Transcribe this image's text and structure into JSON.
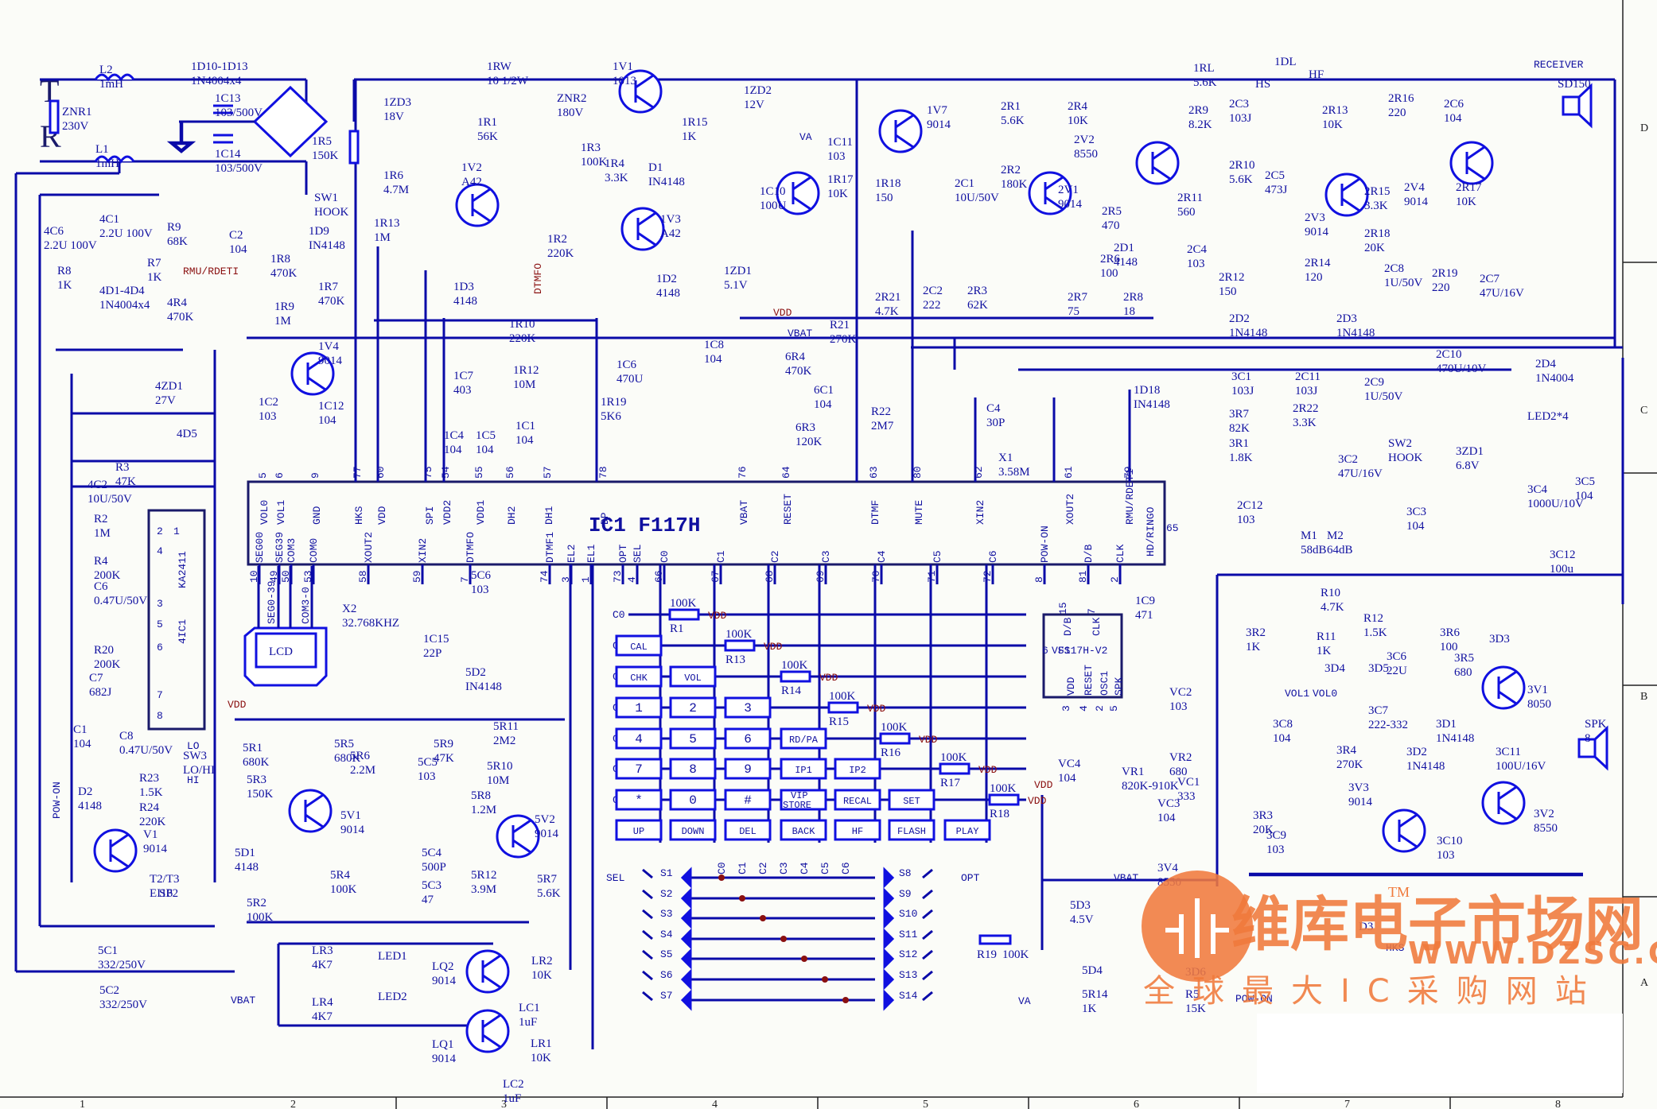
{
  "diagram": {
    "type": "circuit-schematic",
    "main_ic": {
      "name": "IC1",
      "part": "F117H"
    },
    "sub_ic": {
      "part": "F117H-V2"
    },
    "amp_ic": {
      "part": "KA2411",
      "ref": "4IC1"
    },
    "lcd_label": "LCD",
    "receiver_label": "RECEIVER",
    "input_labels": {
      "tip": "T",
      "ring": "R"
    }
  },
  "frame": {
    "columns": [
      "1",
      "2",
      "3",
      "4",
      "5",
      "6",
      "7",
      "8"
    ],
    "rows": [
      "D",
      "C",
      "B",
      "A"
    ]
  },
  "ic_top_pins": [
    {
      "num": "5",
      "name": "VOL0"
    },
    {
      "num": "6",
      "name": "VOL1"
    },
    {
      "num": "9",
      "name": "GND"
    },
    {
      "num": "77",
      "name": "HKS"
    },
    {
      "num": "60",
      "name": "VDD"
    },
    {
      "num": "75",
      "name": "SPI"
    },
    {
      "num": "54",
      "name": "VDD2"
    },
    {
      "num": "55",
      "name": "VDD1"
    },
    {
      "num": "56",
      "name": "DH2"
    },
    {
      "num": "57",
      "name": "DH1"
    },
    {
      "num": "78",
      "name": "DP"
    },
    {
      "num": "76",
      "name": "VBAT"
    },
    {
      "num": "64",
      "name": "RESET"
    },
    {
      "num": "63",
      "name": "DTMF"
    },
    {
      "num": "80",
      "name": "MUTE"
    },
    {
      "num": "62",
      "name": "XIN2"
    },
    {
      "num": "61",
      "name": "XOUT2"
    },
    {
      "num": "79",
      "name": "RMU/RDET1"
    }
  ],
  "ic_bottom_pins": [
    {
      "num": "10",
      "name": "SEG00"
    },
    {
      "num": "49",
      "name": "SEG39"
    },
    {
      "num": "50",
      "name": "COM3"
    },
    {
      "num": "53",
      "name": "COM0"
    },
    {
      "num": "58",
      "name": "XOUT2"
    },
    {
      "num": "59",
      "name": "XIN2"
    },
    {
      "num": "7",
      "name": "DTMFO"
    },
    {
      "num": "74",
      "name": "DTMF1"
    },
    {
      "num": "3",
      "name": "EL2"
    },
    {
      "num": "1",
      "name": "EL1"
    },
    {
      "num": "73",
      "name": "OPT"
    },
    {
      "num": "4",
      "name": "SEL"
    },
    {
      "num": "66",
      "name": "C0"
    },
    {
      "num": "67",
      "name": "C1"
    },
    {
      "num": "68",
      "name": "C2"
    },
    {
      "num": "69",
      "name": "C3"
    },
    {
      "num": "70",
      "name": "C4"
    },
    {
      "num": "71",
      "name": "C5"
    },
    {
      "num": "72",
      "name": "C6"
    },
    {
      "num": "8",
      "name": "POW-ON"
    },
    {
      "num": "81",
      "name": "D/B"
    },
    {
      "num": "2",
      "name": "CLK"
    }
  ],
  "ic_side_pin": {
    "num": "65",
    "name": "HD/RINGO"
  },
  "sub_ic_pins": [
    {
      "num": "15",
      "name": "D/B"
    },
    {
      "num": "7",
      "name": "CLK"
    },
    {
      "num": "6",
      "name": "VSS"
    },
    {
      "num": "3",
      "name": "VDD"
    },
    {
      "num": "4",
      "name": "RESET"
    },
    {
      "num": "2",
      "name": "OSC1"
    },
    {
      "num": "5",
      "name": "SPK"
    }
  ],
  "amp_ic_pins": [
    "1",
    "2",
    "3",
    "4",
    "5",
    "6",
    "7",
    "8"
  ],
  "keypad": {
    "rows": [
      "C0",
      "C1",
      "C2",
      "C3",
      "C4",
      "C5",
      "C6"
    ],
    "keys": [
      [
        "CAL"
      ],
      [
        "CHK",
        "VOL"
      ],
      [
        "1",
        "2",
        "3"
      ],
      [
        "4",
        "5",
        "6",
        "RD/PA"
      ],
      [
        "7",
        "8",
        "9",
        "IP1",
        "IP2"
      ],
      [
        "*",
        "0",
        "#",
        "VIP STORE",
        "RECAL",
        "SET"
      ],
      [
        "UP",
        "DOWN",
        "DEL",
        "BACK",
        "HF",
        "FLASH",
        "PLAY"
      ]
    ],
    "pullups": [
      {
        "ref": "R1",
        "value": "100K"
      },
      {
        "ref": "R13",
        "value": "100K"
      },
      {
        "ref": "R14",
        "value": "100K"
      },
      {
        "ref": "R15",
        "value": "100K"
      },
      {
        "ref": "R16",
        "value": "100K"
      },
      {
        "ref": "R17",
        "value": "100K"
      },
      {
        "ref": "R18",
        "value": "100K"
      }
    ],
    "supply_label": "VDD"
  },
  "option_switches": {
    "left_net": "SEL",
    "right_net": "OPT",
    "left": [
      "S1",
      "S2",
      "S3",
      "S4",
      "S5",
      "S6",
      "S7"
    ],
    "right": [
      "S8",
      "S9",
      "S10",
      "S11",
      "S12",
      "S13",
      "S14"
    ],
    "columns": [
      "C0",
      "C1",
      "C2",
      "C3",
      "C4",
      "C5",
      "C6"
    ],
    "resistor": {
      "ref": "R19",
      "value": "100K"
    }
  },
  "components": [
    {
      "ref": "L2",
      "value": "1mH"
    },
    {
      "ref": "L1",
      "value": "1mH"
    },
    {
      "ref": "ZNR1",
      "value": "230V"
    },
    {
      "ref": "1C13",
      "value": "103/500V"
    },
    {
      "ref": "1C14",
      "value": "103/500V"
    },
    {
      "ref": "1D10-1D13",
      "value": "1N4004x4"
    },
    {
      "ref": "1R5",
      "value": "150K"
    },
    {
      "ref": "SW1",
      "value": "HOOK"
    },
    {
      "ref": "1ZD3",
      "value": "18V"
    },
    {
      "ref": "1R6",
      "value": "4.7M"
    },
    {
      "ref": "1R13",
      "value": "1M"
    },
    {
      "ref": "1RW",
      "value": "10 1/2W"
    },
    {
      "ref": "1R1",
      "value": "56K"
    },
    {
      "ref": "1V2",
      "value": "A42"
    },
    {
      "ref": "1R2",
      "value": "220K"
    },
    {
      "ref": "ZNR2",
      "value": "180V"
    },
    {
      "ref": "1V1",
      "value": "1013"
    },
    {
      "ref": "1R3",
      "value": "100K"
    },
    {
      "ref": "1R4",
      "value": "3.3K"
    },
    {
      "ref": "1V3",
      "value": "A42"
    },
    {
      "ref": "1R15",
      "value": "1K"
    },
    {
      "ref": "D1",
      "value": "IN4148"
    },
    {
      "ref": "1D2",
      "value": "4148"
    },
    {
      "ref": "1ZD1",
      "value": "5.1V"
    },
    {
      "ref": "1ZD2",
      "value": "12V"
    },
    {
      "ref": "1C10",
      "value": "100U"
    },
    {
      "ref": "1C11",
      "value": "103"
    },
    {
      "ref": "1R17",
      "value": "10K"
    },
    {
      "ref": "1R18",
      "value": "150"
    },
    {
      "ref": "1V7",
      "value": "9014"
    },
    {
      "ref": "2C1",
      "value": "10U/50V"
    },
    {
      "ref": "2R1",
      "value": "5.6K"
    },
    {
      "ref": "2R2",
      "value": "180K"
    },
    {
      "ref": "2R3",
      "value": "62K"
    },
    {
      "ref": "2C2",
      "value": "222"
    },
    {
      "ref": "2R21",
      "value": "4.7K"
    },
    {
      "ref": "2R4",
      "value": "10K"
    },
    {
      "ref": "2V1",
      "value": "9014"
    },
    {
      "ref": "2V2",
      "value": "8550"
    },
    {
      "ref": "2R5",
      "value": "470"
    },
    {
      "ref": "2R6",
      "value": "100"
    },
    {
      "ref": "2D1",
      "value": "4148"
    },
    {
      "ref": "2R7",
      "value": "75"
    },
    {
      "ref": "2R8",
      "value": "18"
    },
    {
      "ref": "1RL",
      "value": "5.6K"
    },
    {
      "ref": "1DL",
      "value": ""
    },
    {
      "ref": "HS",
      "value": ""
    },
    {
      "ref": "HF",
      "value": ""
    },
    {
      "ref": "2R9",
      "value": "8.2K"
    },
    {
      "ref": "2C3",
      "value": "103J"
    },
    {
      "ref": "2R10",
      "value": "5.6K"
    },
    {
      "ref": "2R11",
      "value": "560"
    },
    {
      "ref": "2C4",
      "value": "103"
    },
    {
      "ref": "2R12",
      "value": "150"
    },
    {
      "ref": "2C5",
      "value": "473J"
    },
    {
      "ref": "2D2",
      "value": "1N4148"
    },
    {
      "ref": "2R13",
      "value": "10K"
    },
    {
      "ref": "2V3",
      "value": "9014"
    },
    {
      "ref": "2R14",
      "value": "120"
    },
    {
      "ref": "2R15",
      "value": "3.3K"
    },
    {
      "ref": "2R16",
      "value": "220"
    },
    {
      "ref": "2C6",
      "value": "104"
    },
    {
      "ref": "2V4",
      "value": "9014"
    },
    {
      "ref": "2R17",
      "value": "10K"
    },
    {
      "ref": "2R18",
      "value": "20K"
    },
    {
      "ref": "2C8",
      "value": "1U/50V"
    },
    {
      "ref": "2R19",
      "value": "220"
    },
    {
      "ref": "2C7",
      "value": "47U/16V"
    },
    {
      "ref": "2D3",
      "value": "1N4148"
    },
    {
      "ref": "SD150",
      "value": ""
    },
    {
      "ref": "4C1",
      "value": "2.2U 100V"
    },
    {
      "ref": "4C6",
      "value": "2.2U 100V"
    },
    {
      "ref": "R8",
      "value": "1K"
    },
    {
      "ref": "R7",
      "value": "1K"
    },
    {
      "ref": "R9",
      "value": "68K"
    },
    {
      "ref": "C2",
      "value": "104"
    },
    {
      "ref": "4R4",
      "value": "470K"
    },
    {
      "ref": "4D1-4D4",
      "value": "1N4004x4"
    },
    {
      "ref": "1R8",
      "value": "470K"
    },
    {
      "ref": "1R9",
      "value": "1M"
    },
    {
      "ref": "1D9",
      "value": "IN4148"
    },
    {
      "ref": "1R7",
      "value": "470K"
    },
    {
      "ref": "1D3",
      "value": "4148"
    },
    {
      "ref": "1V4",
      "value": "9014"
    },
    {
      "ref": "1C2",
      "value": "103"
    },
    {
      "ref": "1C12",
      "value": "104"
    },
    {
      "ref": "4ZD1",
      "value": "27V"
    },
    {
      "ref": "4D5",
      "value": ""
    },
    {
      "ref": "R3",
      "value": "47K"
    },
    {
      "ref": "4C2",
      "value": "10U/50V"
    },
    {
      "ref": "R2",
      "value": "1M"
    },
    {
      "ref": "R4",
      "value": "200K"
    },
    {
      "ref": "C6",
      "value": "0.47U/50V"
    },
    {
      "ref": "R20",
      "value": "200K"
    },
    {
      "ref": "C7",
      "value": "682J"
    },
    {
      "ref": "C1",
      "value": "104"
    },
    {
      "ref": "C8",
      "value": "0.47U/50V"
    },
    {
      "ref": "SW3",
      "value": "LO/HI"
    },
    {
      "ref": "R23",
      "value": "1.5K"
    },
    {
      "ref": "R24",
      "value": "220K"
    },
    {
      "ref": "D2",
      "value": "4148"
    },
    {
      "ref": "V1",
      "value": "9014"
    },
    {
      "ref": "T2/T3",
      "value": "EI16"
    },
    {
      "ref": "SP2",
      "value": ""
    },
    {
      "ref": "5C1",
      "value": "332/250V"
    },
    {
      "ref": "5C2",
      "value": "332/250V"
    },
    {
      "ref": "1R10",
      "value": "220K"
    },
    {
      "ref": "1C7",
      "value": "403"
    },
    {
      "ref": "1R12",
      "value": "10M"
    },
    {
      "ref": "1C4",
      "value": "104"
    },
    {
      "ref": "1C5",
      "value": "104"
    },
    {
      "ref": "1C1",
      "value": "104"
    },
    {
      "ref": "1R19",
      "value": "5K6"
    },
    {
      "ref": "1C6",
      "value": "470U"
    },
    {
      "ref": "1C8",
      "value": "104"
    },
    {
      "ref": "6R4",
      "value": "470K"
    },
    {
      "ref": "6C1",
      "value": "104"
    },
    {
      "ref": "6R3",
      "value": "120K"
    },
    {
      "ref": "R21",
      "value": "270K"
    },
    {
      "ref": "R22",
      "value": "2M7"
    },
    {
      "ref": "C4",
      "value": "30P"
    },
    {
      "ref": "X1",
      "value": "3.58M"
    },
    {
      "ref": "1D18",
      "value": "IN4148"
    },
    {
      "ref": "X2",
      "value": "32.768KHZ"
    },
    {
      "ref": "1C15",
      "value": "22P"
    },
    {
      "ref": "5C6",
      "value": "103"
    },
    {
      "ref": "5D2",
      "value": "IN4148"
    },
    {
      "ref": "5R1",
      "value": "680K"
    },
    {
      "ref": "5R3",
      "value": "150K"
    },
    {
      "ref": "5V1",
      "value": "9014"
    },
    {
      "ref": "5R5",
      "value": "680K"
    },
    {
      "ref": "5R6",
      "value": "2.2M"
    },
    {
      "ref": "5C5",
      "value": "103"
    },
    {
      "ref": "5R9",
      "value": "47K"
    },
    {
      "ref": "5R11",
      "value": "2M2"
    },
    {
      "ref": "5R10",
      "value": "10M"
    },
    {
      "ref": "5R8",
      "value": "1.2M"
    },
    {
      "ref": "5V2",
      "value": "9014"
    },
    {
      "ref": "5C4",
      "value": "500P"
    },
    {
      "ref": "5C3",
      "value": "47"
    },
    {
      "ref": "5R4",
      "value": "100K"
    },
    {
      "ref": "5R12",
      "value": "3.9M"
    },
    {
      "ref": "5R7",
      "value": "5.6K"
    },
    {
      "ref": "5R2",
      "value": "100K"
    },
    {
      "ref": "5D1",
      "value": "4148"
    },
    {
      "ref": "LR3",
      "value": "4K7"
    },
    {
      "ref": "LR4",
      "value": "4K7"
    },
    {
      "ref": "LED1",
      "value": ""
    },
    {
      "ref": "LED2",
      "value": ""
    },
    {
      "ref": "LQ2",
      "value": "9014"
    },
    {
      "ref": "LQ1",
      "value": "9014"
    },
    {
      "ref": "LR2",
      "value": "10K"
    },
    {
      "ref": "LR1",
      "value": "10K"
    },
    {
      "ref": "LC1",
      "value": "1uF"
    },
    {
      "ref": "LC2",
      "value": "1uF"
    },
    {
      "ref": "1C9",
      "value": "471"
    },
    {
      "ref": "VC2",
      "value": "103"
    },
    {
      "ref": "VR2",
      "value": "680"
    },
    {
      "ref": "VR1",
      "value": "820K-910K"
    },
    {
      "ref": "VC4",
      "value": "104"
    },
    {
      "ref": "VC1",
      "value": "333"
    },
    {
      "ref": "VC3",
      "value": "104"
    },
    {
      "ref": "5D3",
      "value": "4.5V"
    },
    {
      "ref": "3V4",
      "value": "8550"
    },
    {
      "ref": "5D4",
      "value": ""
    },
    {
      "ref": "5R14",
      "value": "1K"
    },
    {
      "ref": "3D6",
      "value": ""
    },
    {
      "ref": "R5",
      "value": "15K"
    },
    {
      "ref": "3C1",
      "value": "103J"
    },
    {
      "ref": "2C11",
      "value": "103J"
    },
    {
      "ref": "2C9",
      "value": "1U/50V"
    },
    {
      "ref": "3R7",
      "value": "82K"
    },
    {
      "ref": "2R22",
      "value": "3.3K"
    },
    {
      "ref": "3R1",
      "value": "1.8K"
    },
    {
      "ref": "SW2",
      "value": "HOOK"
    },
    {
      "ref": "2C10",
      "value": "470U/10V"
    },
    {
      "ref": "2D4",
      "value": "1N4004"
    },
    {
      "ref": "LED2*4",
      "value": ""
    },
    {
      "ref": "3ZD1",
      "value": "6.8V"
    },
    {
      "ref": "3C4",
      "value": "1000U/10V"
    },
    {
      "ref": "3C5",
      "value": "104"
    },
    {
      "ref": "3C2",
      "value": "47U/16V"
    },
    {
      "ref": "2C12",
      "value": "103"
    },
    {
      "ref": "3C3",
      "value": "104"
    },
    {
      "ref": "M1",
      "value": "58dB"
    },
    {
      "ref": "M2",
      "value": "64dB"
    },
    {
      "ref": "3C12",
      "value": "100u"
    },
    {
      "ref": "3R2",
      "value": "1K"
    },
    {
      "ref": "R11",
      "value": "1K"
    },
    {
      "ref": "R10",
      "value": "4.7K"
    },
    {
      "ref": "R12",
      "value": "1.5K"
    },
    {
      "ref": "3D4",
      "value": ""
    },
    {
      "ref": "3D5",
      "value": ""
    },
    {
      "ref": "3C6",
      "value": "22U"
    },
    {
      "ref": "3R6",
      "value": "100"
    },
    {
      "ref": "3D3",
      "value": ""
    },
    {
      "ref": "3R5",
      "value": "680"
    },
    {
      "ref": "3V1",
      "value": "8050"
    },
    {
      "ref": "3C7",
      "value": "222-332"
    },
    {
      "ref": "3C8",
      "value": "104"
    },
    {
      "ref": "3R4",
      "value": "270K"
    },
    {
      "ref": "3D1",
      "value": "1N4148"
    },
    {
      "ref": "3D2",
      "value": "1N4148"
    },
    {
      "ref": "3C11",
      "value": "100U/16V"
    },
    {
      "ref": "3V3",
      "value": "9014"
    },
    {
      "ref": "3V2",
      "value": "8550"
    },
    {
      "ref": "3R3",
      "value": "20K"
    },
    {
      "ref": "3C9",
      "value": "103"
    },
    {
      "ref": "3C10",
      "value": "103"
    },
    {
      "ref": "SPK",
      "value": "8"
    },
    {
      "ref": "D3",
      "value": ""
    }
  ],
  "net_labels": {
    "rmu": "RMU/RDETI",
    "dtmfo": "DTMFO",
    "vdd": "VDD",
    "vbat": "VBAT",
    "va": "VA",
    "pow_on": "POW-ON",
    "vol1": "VOL1",
    "vol0": "VOL0",
    "hks": "HKS",
    "seg": "SEG0-39",
    "com": "COM3-0",
    "lo": "LO",
    "hi": "HI"
  },
  "watermark": {
    "brand": "维库电子市场网",
    "tm": "TM",
    "url": "WWW.DZSC.COM",
    "slogan": "全球最大IC采购网站",
    "color": "#f07a3c"
  }
}
